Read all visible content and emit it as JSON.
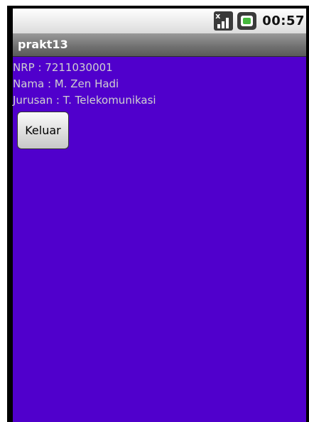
{
  "status_bar": {
    "time": "00:57",
    "icons": [
      "signal-icon",
      "battery-icon"
    ],
    "signal_mark": "x"
  },
  "app": {
    "title": "prakt13",
    "background_color": "#5000cc"
  },
  "info": {
    "nrp": "NRP : 7211030001",
    "nama": "Nama : M. Zen Hadi",
    "jurusan": "Jurusan : T. Telekomunikasi"
  },
  "buttons": {
    "keluar_label": "Keluar"
  }
}
